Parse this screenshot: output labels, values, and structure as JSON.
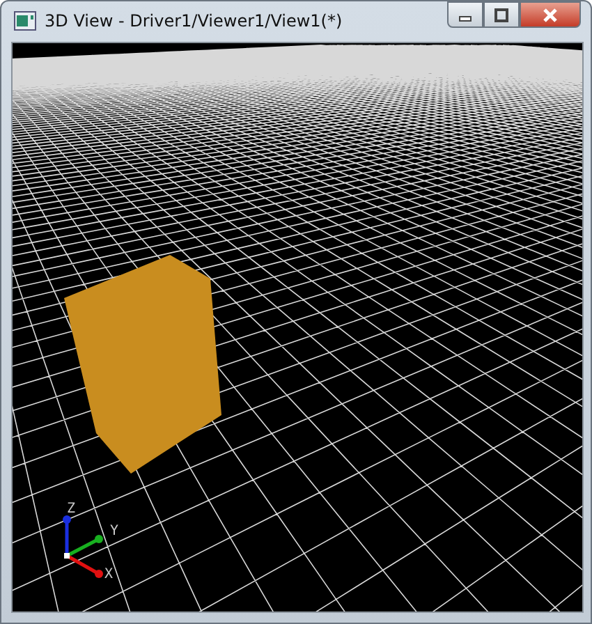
{
  "window": {
    "title": "3D View - Driver1/Viewer1/View1(*)"
  },
  "axes": [
    {
      "kind": "z",
      "label": "Z"
    },
    {
      "kind": "y",
      "label": "Y"
    },
    {
      "kind": "x",
      "label": "X"
    }
  ]
}
